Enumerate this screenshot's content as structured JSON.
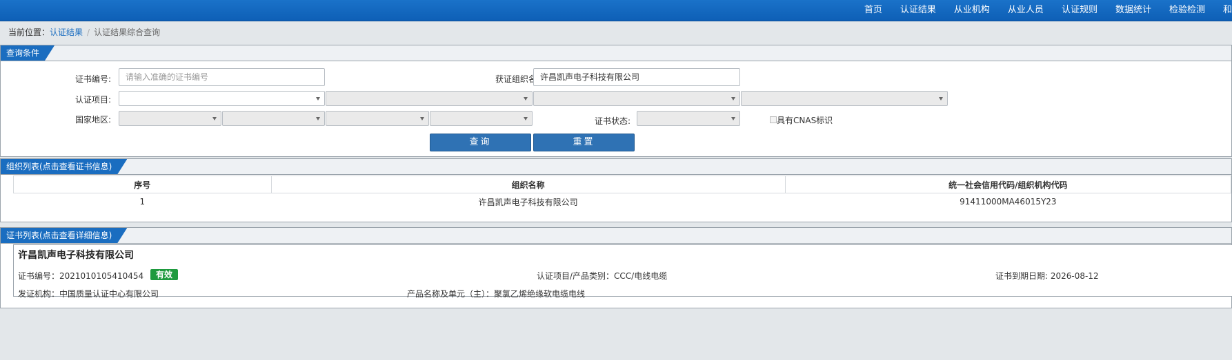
{
  "nav": {
    "items": [
      "首页",
      "认证结果",
      "从业机构",
      "从业人员",
      "认证规则",
      "数据统计",
      "检验检测",
      "和"
    ]
  },
  "breadcrumb": {
    "prefix": "当前位置：",
    "link": "认证结果",
    "separator": "/",
    "current": "认证结果综合查询"
  },
  "query": {
    "title": "查询条件",
    "cert_no_label": "证书编号:",
    "cert_no_placeholder": "请输入准确的证书编号",
    "org_name_label": "获证组织名称:",
    "org_name_value": "许昌凯声电子科技有限公司",
    "project_label": "认证项目:",
    "region_label": "国家地区:",
    "status_label": "证书状态:",
    "cnas_label": "具有CNAS标识",
    "search_button": "查询",
    "reset_button": "重置"
  },
  "org_list": {
    "title": "组织列表(点击查看证书信息)",
    "columns": [
      "序号",
      "组织名称",
      "统一社会信用代码/组织机构代码"
    ],
    "rows": [
      [
        "1",
        "许昌凯声电子科技有限公司",
        "91411000MA46015Y23"
      ]
    ]
  },
  "cert_list": {
    "title": "证书列表(点击查看详细信息)",
    "cards": [
      {
        "company": "许昌凯声电子科技有限公司",
        "cert_no": "证书编号：2021010105410454",
        "status": "有效",
        "status_color": "#1e9a3e",
        "project": "认证项目/产品类别：CCC/电线电缆",
        "expiry": "证书到期日期: 2026-08-12",
        "issuer": "发证机构：中国质量认证中心有限公司",
        "product": "产品名称及单元（主）：聚氯乙烯绝缘软电缆电线"
      }
    ]
  }
}
